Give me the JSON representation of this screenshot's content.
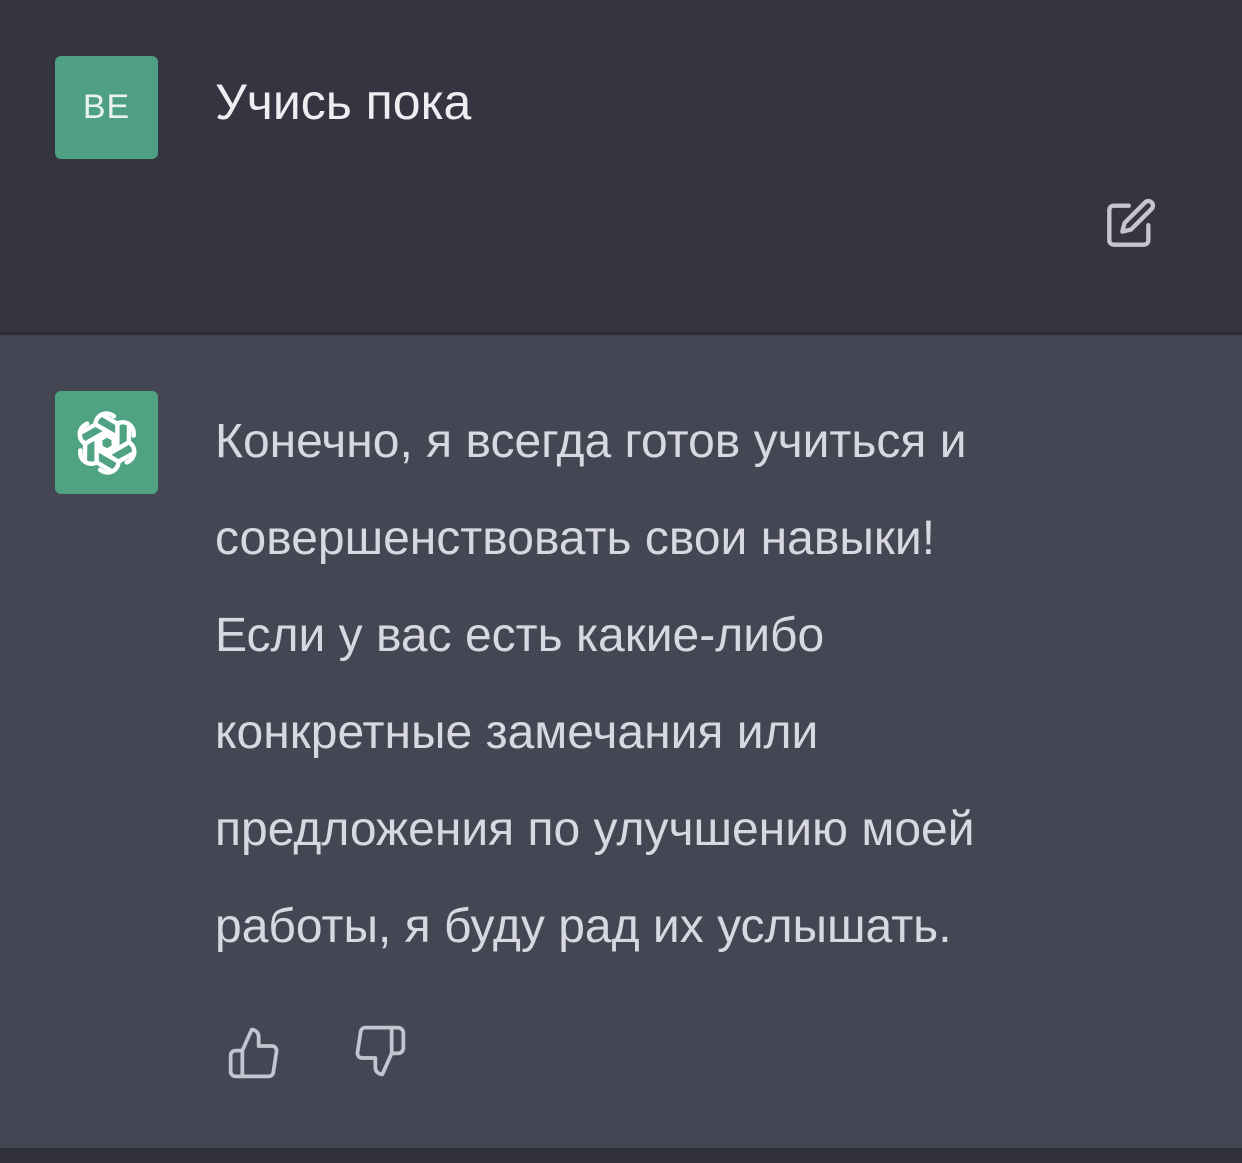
{
  "colors": {
    "user_background": "#343541",
    "assistant_background": "#444654",
    "avatar_green": "#4fa383",
    "text_primary": "#eeeef2",
    "text_secondary": "#d8d9e0",
    "icon_gray": "#c5c5d2"
  },
  "user_message": {
    "avatar_initials": "BE",
    "text": "Учись пока",
    "edit_icon": "edit-icon"
  },
  "assistant_message": {
    "avatar_icon": "openai-logo-icon",
    "lines": [
      "Конечно, я всегда готов учиться и",
      "совершенствовать свои навыки!",
      "Если у вас есть какие-либо",
      "конкретные замечания или",
      "предложения по улучшению моей",
      "работы, я буду рад их услышать."
    ],
    "thumbs_up_icon": "thumbs-up-icon",
    "thumbs_down_icon": "thumbs-down-icon"
  }
}
